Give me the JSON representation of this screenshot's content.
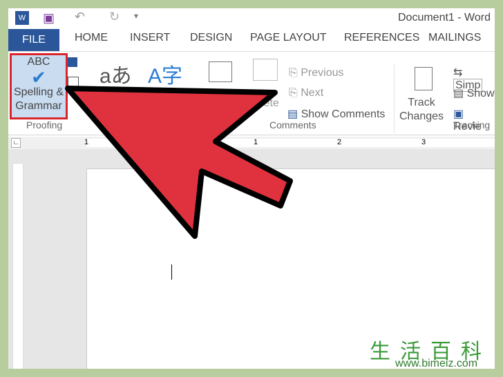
{
  "title": "Document1 - Word",
  "tabs": [
    "FILE",
    "HOME",
    "INSERT",
    "DESIGN",
    "PAGE LAYOUT",
    "REFERENCES",
    "MAILINGS"
  ],
  "proofing": {
    "abc": "ABC",
    "button1": "Spelling &",
    "button2": "Grammar",
    "group": "Proofing"
  },
  "comments": {
    "previous": "Previous",
    "next": "Next",
    "delete": "lete",
    "show": "Show Comments",
    "group": "Comments"
  },
  "tracking": {
    "track1": "Track",
    "track2": "Changes",
    "simple": "Simp",
    "show": "Show",
    "review": "Revie",
    "group": "Tracking"
  },
  "ruler": [
    "1",
    "1",
    "2",
    "3"
  ],
  "watermark": {
    "cn": "生活百科",
    "url": "www.bimeiz.com"
  },
  "colors": {
    "accent": "#2b579a",
    "arrow": "#e0323e",
    "highlight": "#d9262d"
  }
}
